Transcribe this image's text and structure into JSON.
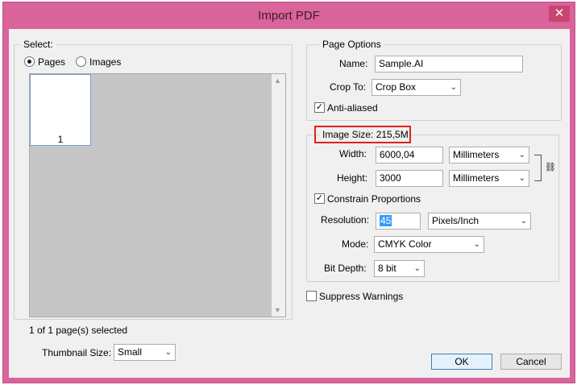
{
  "window": {
    "title": "Import PDF",
    "close_glyph": "✕"
  },
  "select": {
    "legend": "Select:",
    "pages_label": "Pages",
    "images_label": "Images",
    "selected_option": "Pages",
    "thumbnail_page_number": "1",
    "status": "1 of 1 page(s) selected",
    "thumbnail_size_label": "Thumbnail Size:",
    "thumbnail_size_value": "Small"
  },
  "page_options": {
    "legend": "Page Options",
    "name_label": "Name:",
    "name_value": "Sample.AI",
    "crop_label": "Crop To:",
    "crop_value": "Crop Box",
    "antialiased_label": "Anti-aliased",
    "antialiased_checked": true
  },
  "image_size": {
    "legend": "Image Size: 215,5M",
    "width_label": "Width:",
    "width_value": "6000,04",
    "width_unit": "Millimeters",
    "height_label": "Height:",
    "height_value": "3000",
    "height_unit": "Millimeters",
    "constrain_label": "Constrain Proportions",
    "constrain_checked": true,
    "resolution_label": "Resolution:",
    "resolution_value": "45",
    "resolution_unit": "Pixels/Inch",
    "mode_label": "Mode:",
    "mode_value": "CMYK Color",
    "bitdepth_label": "Bit Depth:",
    "bitdepth_value": "8 bit"
  },
  "suppress_warnings_label": "Suppress Warnings",
  "buttons": {
    "ok": "OK",
    "cancel": "Cancel"
  },
  "icons": {
    "dropdown_arrow": "⌄",
    "checkmark": "✓",
    "scroll_up": "▲",
    "scroll_down": "▼",
    "chain": "⛓"
  },
  "colors": {
    "title_bar": "#d9649b",
    "close_button": "#c7456f",
    "highlight_box": "#e02020",
    "selection": "#3399ff"
  }
}
